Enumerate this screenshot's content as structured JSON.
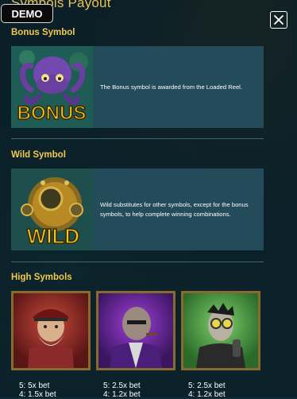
{
  "header": {
    "title": "Symbols Payout",
    "demo_label": "DEMO",
    "close_icon": "close-icon"
  },
  "sections": {
    "bonus": {
      "title": "Bonus Symbol",
      "symbol_text": "BONUS",
      "description": "The Bonus symbol is awarded from the Loaded Reel."
    },
    "wild": {
      "title": "Wild Symbol",
      "symbol_text": "WILD",
      "description": "Wild substitutes for other symbols, except for the bonus symbols, to help complete winning combinations."
    },
    "high": {
      "title": "High Symbols",
      "symbols": [
        {
          "name": "pirate-captain",
          "pays": [
            "5: 5x bet",
            "4: 1.5x bet"
          ]
        },
        {
          "name": "bald-gangster",
          "pays": [
            "5: 2.5x bet",
            "4: 1.2x bet"
          ]
        },
        {
          "name": "goggles-scientist",
          "pays": [
            "5: 2.5x bet",
            "4: 1.2x bet"
          ]
        }
      ]
    }
  },
  "colors": {
    "accent": "#f0c850",
    "card_bg": "#234b5a",
    "frame_gold": "#8a6a2c"
  }
}
